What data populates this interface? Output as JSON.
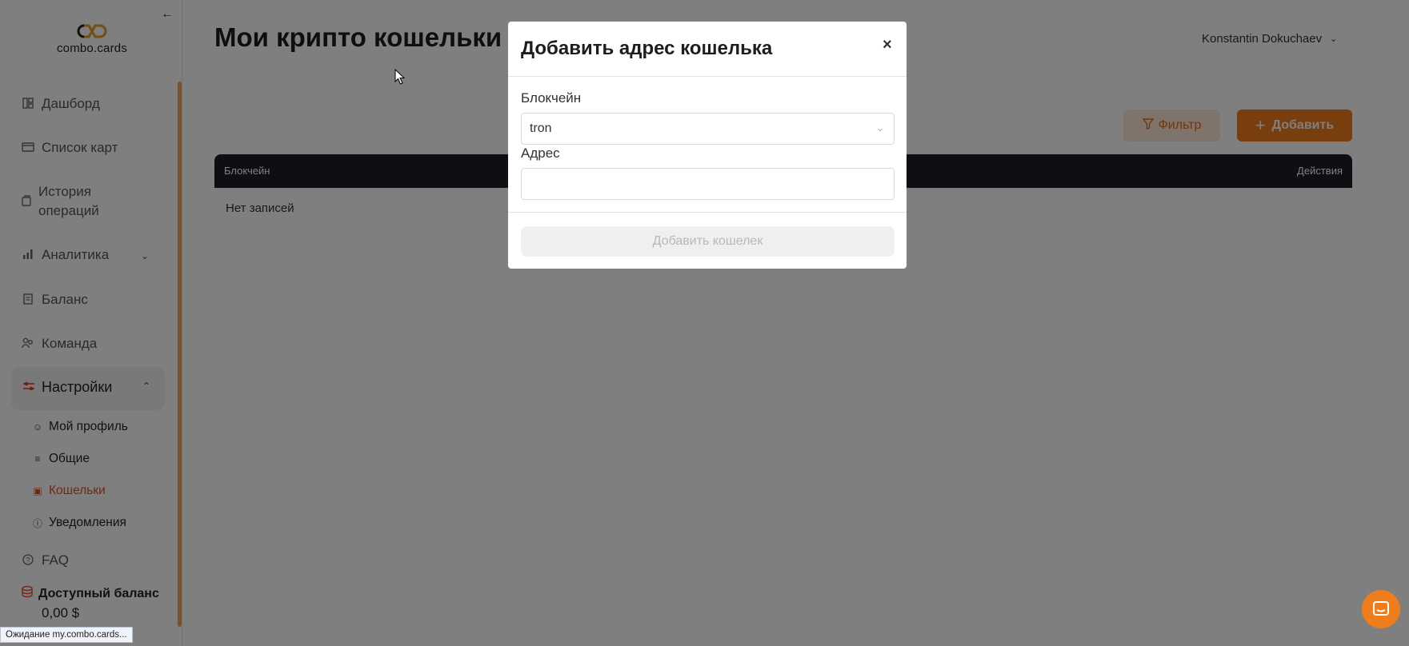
{
  "sidebar": {
    "logo_text": "combo.cards",
    "nav": [
      {
        "label": "Дашборд",
        "icon": "dashboard-icon"
      },
      {
        "label": "Список карт",
        "icon": "card-icon"
      },
      {
        "label": "История операций",
        "icon": "history-icon"
      },
      {
        "label": "Аналитика",
        "icon": "chart-icon"
      },
      {
        "label": "Баланс",
        "icon": "receipt-icon"
      },
      {
        "label": "Команда",
        "icon": "team-icon"
      }
    ],
    "settings": {
      "label": "Настройки",
      "icon": "sliders-icon"
    },
    "sub_items": [
      {
        "label": "Мой профиль",
        "icon": "user-icon"
      },
      {
        "label": "Общие",
        "icon": "sliders-icon"
      },
      {
        "label": "Кошельки",
        "icon": "wallet-icon",
        "active": true
      },
      {
        "label": "Уведомления",
        "icon": "info-icon"
      }
    ],
    "faq": {
      "label": "FAQ",
      "icon": "help-icon"
    },
    "balance": {
      "label": "Доступный баланс",
      "amount": "0,00 $"
    }
  },
  "status_tip": "Ожидание my.combo.cards...",
  "main": {
    "title": "Мои крипто кошельки",
    "user_name": "Konstantin Dokuchaev",
    "filter_label": "Фильтр",
    "add_label": "Добавить",
    "table": {
      "columns": [
        "Блокчейн",
        "Действия"
      ],
      "empty_text": "Нет записей"
    }
  },
  "modal": {
    "title": "Добавить адрес кошелька",
    "close": "×",
    "blockchain_label": "Блокчейн",
    "blockchain_value": "tron",
    "address_label": "Адрес",
    "address_value": "",
    "submit_label": "Добавить кошелек"
  },
  "colors": {
    "accent": "#f07d1c",
    "active_nav": "#e0502a",
    "table_header": "#1c1e24",
    "overlay": "rgba(0,0,0,0.5)"
  }
}
